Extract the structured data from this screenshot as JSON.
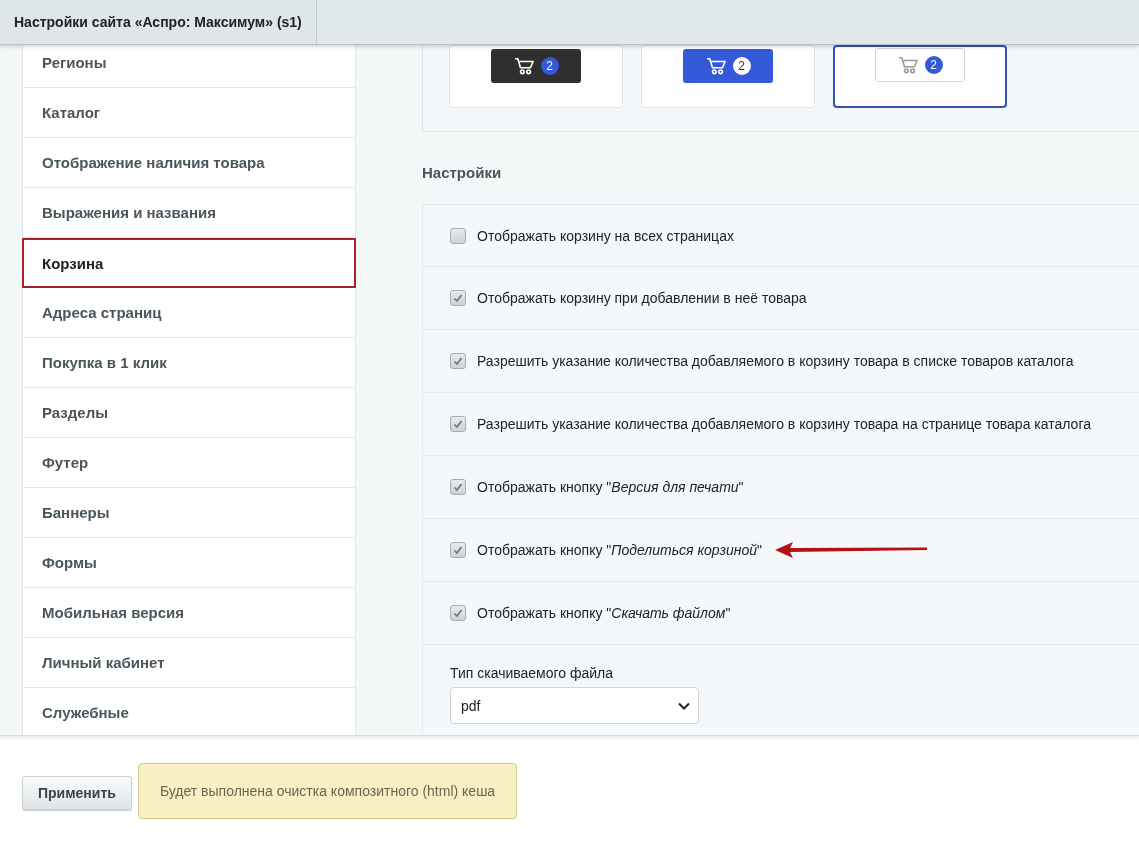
{
  "tab": {
    "title": "Настройки сайта «Аспро: Максимум» (s1)"
  },
  "sidebar": {
    "items": [
      {
        "label": "Регионы",
        "selected": false
      },
      {
        "label": "Каталог",
        "selected": false
      },
      {
        "label": "Отображение наличия товара",
        "selected": false
      },
      {
        "label": "Выражения и названия",
        "selected": false
      },
      {
        "label": "Корзина",
        "selected": true
      },
      {
        "label": "Адреса страниц",
        "selected": false
      },
      {
        "label": "Покупка в 1 клик",
        "selected": false
      },
      {
        "label": "Разделы",
        "selected": false
      },
      {
        "label": "Футер",
        "selected": false
      },
      {
        "label": "Баннеры",
        "selected": false
      },
      {
        "label": "Формы",
        "selected": false
      },
      {
        "label": "Мобильная версия",
        "selected": false
      },
      {
        "label": "Личный кабинет",
        "selected": false
      },
      {
        "label": "Служебные",
        "selected": false
      }
    ]
  },
  "cart_styles": [
    {
      "kind": "dark",
      "badge": "2",
      "selected": false
    },
    {
      "kind": "blue",
      "badge": "2",
      "selected": false
    },
    {
      "kind": "light",
      "badge": "2",
      "selected": true
    }
  ],
  "settings": {
    "heading": "Настройки",
    "options": [
      {
        "label": "Отображать корзину на всех страницах",
        "checked": false,
        "annotated": false
      },
      {
        "label": "Отображать корзину при добавлении в неё товара",
        "checked": true,
        "annotated": false
      },
      {
        "label": "Разрешить указание количества добавляемого в корзину товара в списке товаров каталога",
        "checked": true,
        "annotated": false
      },
      {
        "label": "Разрешить указание количества добавляемого в корзину товара на странице товара каталога",
        "checked": true,
        "annotated": false
      },
      {
        "label": "Отображать кнопку \"*Версия для печати*\"",
        "checked": true,
        "annotated": false
      },
      {
        "label": "Отображать кнопку \"*Поделиться корзиной*\"",
        "checked": true,
        "annotated": true
      },
      {
        "label": "Отображать кнопку \"*Скачать файлом*\"",
        "checked": true,
        "annotated": false
      }
    ],
    "file_type": {
      "label": "Тип скачиваемого файла",
      "value": "pdf"
    }
  },
  "footer": {
    "apply": "Применить",
    "note": "Будет выполнена очистка композитного (html) кеша"
  }
}
